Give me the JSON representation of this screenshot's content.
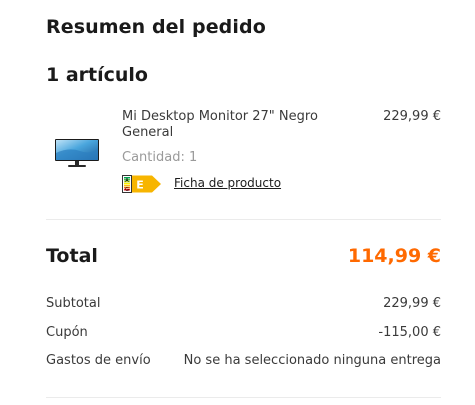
{
  "summary": {
    "title": "Resumen del pedido",
    "item_count": "1 artículo"
  },
  "item": {
    "name": "Mi Desktop Monitor 27\" Negro General",
    "price": "229,99 €",
    "quantity": "Cantidad: 1",
    "product_sheet_link": "Ficha de producto",
    "energy_label": {
      "scale_top": "A",
      "scale_bottom": "G",
      "class": "E",
      "color": "#f7b500"
    }
  },
  "totals": {
    "total_label": "Total",
    "total_value": "114,99 €",
    "total_color": "#ff6900",
    "rows": [
      {
        "label": "Subtotal",
        "value": "229,99 €"
      },
      {
        "label": "Cupón",
        "value": "-115,00 €"
      },
      {
        "label": "Gastos de envío",
        "value": "No se ha seleccionado ninguna entrega"
      }
    ]
  }
}
